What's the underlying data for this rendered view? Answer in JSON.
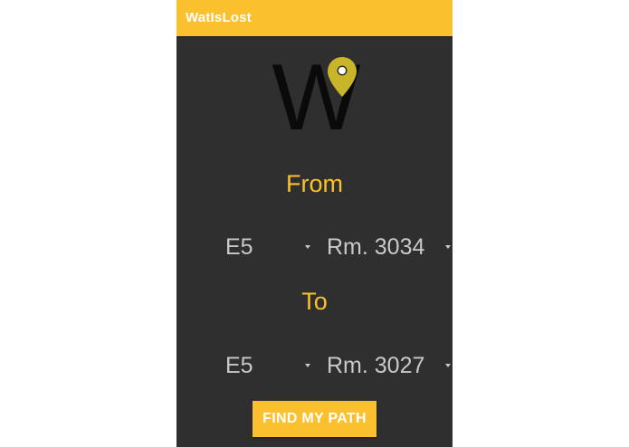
{
  "app_bar": {
    "title": "WatIsLost",
    "color": "#fbc02d"
  },
  "logo": {
    "letter": "W",
    "icon": "map-pin-icon",
    "pin_color": "#c8b52a"
  },
  "from": {
    "label": "From",
    "building": "E5",
    "room": "Rm. 3034"
  },
  "to": {
    "label": "To",
    "building": "E5",
    "room": "Rm. 3027"
  },
  "find_button": {
    "label": "FIND MY PATH"
  },
  "colors": {
    "background": "#2f2f2f",
    "accent": "#fbc02d",
    "select_text": "#c9c9c9"
  }
}
